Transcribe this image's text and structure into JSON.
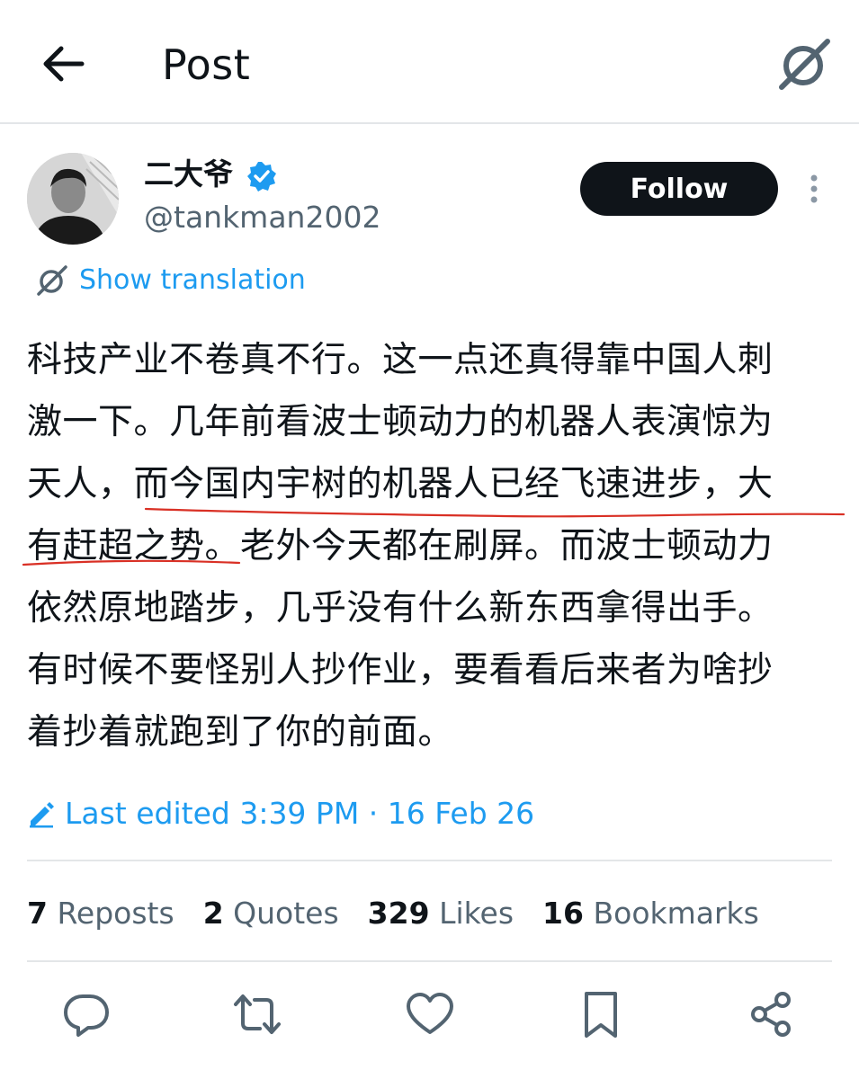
{
  "header": {
    "title": "Post",
    "back_icon": "arrow-left-icon",
    "grok_icon": "grok-icon"
  },
  "author": {
    "display_name": "二大爷",
    "handle": "@tankman2002",
    "verified": true,
    "follow_label": "Follow"
  },
  "translation": {
    "label": "Show translation"
  },
  "post": {
    "lines": [
      "科技产业不卷真不行。这一点还真得靠中国人刺",
      "激一下。几年前看波士顿动力的机器人表演惊为",
      "天人，而今国内宇树的机器人已经飞速进步，大",
      "有赶超之势。老外今天都在刷屏。而波士顿动力",
      "依然原地踏步，几乎没有什么新东西拿得出手。",
      "有时候不要怪别人抄作业，要看看后来者为啥抄",
      "着抄着就跑到了你的前面。"
    ],
    "annotation_color": "#d93025"
  },
  "edited": {
    "label": "Last edited 3:39 PM · 16 Feb 26"
  },
  "stats": [
    {
      "count": "7",
      "label": "Reposts"
    },
    {
      "count": "2",
      "label": "Quotes"
    },
    {
      "count": "329",
      "label": "Likes"
    },
    {
      "count": "16",
      "label": "Bookmarks"
    }
  ],
  "actions": [
    "reply-icon",
    "repost-icon",
    "like-icon",
    "bookmark-icon",
    "share-icon"
  ],
  "colors": {
    "accent": "#1d9bf0",
    "text": "#0f1419",
    "secondary": "#536471",
    "divider": "#e3e6e8"
  }
}
